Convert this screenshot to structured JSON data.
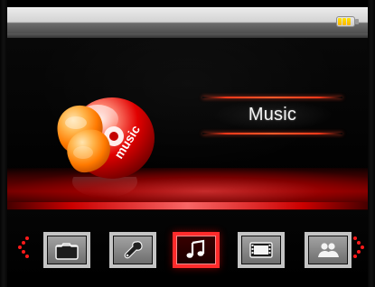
{
  "status_bar": {
    "battery_icon": "battery-icon"
  },
  "main_menu": {
    "selected_label": "Music",
    "selected_logo_text": "music",
    "accent_color": "#ff2b2b",
    "items": [
      {
        "name": "folder",
        "icon": "folder-icon"
      },
      {
        "name": "settings",
        "icon": "wrench-icon"
      },
      {
        "name": "music",
        "icon": "music-note-icon"
      },
      {
        "name": "video",
        "icon": "film-icon"
      },
      {
        "name": "photos",
        "icon": "people-icon"
      }
    ]
  }
}
